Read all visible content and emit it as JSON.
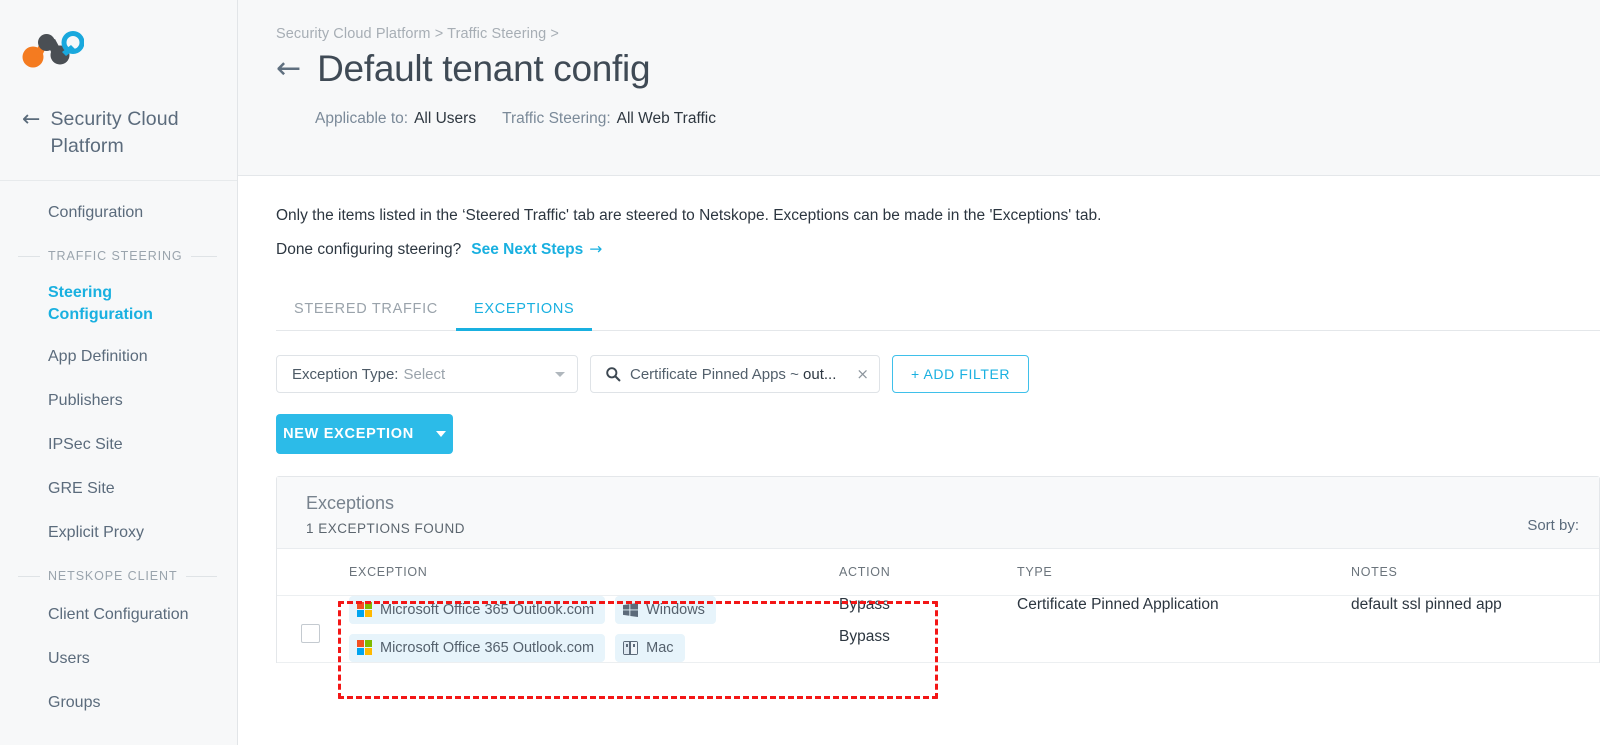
{
  "sidebar": {
    "logo_name": "netskope-logo",
    "back_arrow": "←",
    "brand": "Security Cloud Platform",
    "items": [
      {
        "label": "Configuration",
        "active": false
      },
      {
        "label": "Steering Configuration",
        "active": true
      },
      {
        "label": "App Definition",
        "active": false
      },
      {
        "label": "Publishers",
        "active": false
      },
      {
        "label": "IPSec Site",
        "active": false
      },
      {
        "label": "GRE Site",
        "active": false
      },
      {
        "label": "Explicit Proxy",
        "active": false
      },
      {
        "label": "Client Configuration",
        "active": false
      },
      {
        "label": "Users",
        "active": false
      },
      {
        "label": "Groups",
        "active": false
      }
    ],
    "group_traffic_steering": "TRAFFIC STEERING",
    "group_netskope_client": "NETSKOPE CLIENT"
  },
  "header": {
    "breadcrumb": "Security Cloud Platform > Traffic Steering >",
    "back_arrow": "←",
    "title": "Default tenant config",
    "meta": [
      {
        "label": "Applicable to:",
        "value": "All Users"
      },
      {
        "label": "Traffic Steering:",
        "value": "All Web Traffic"
      }
    ]
  },
  "body": {
    "info_line": "Only the items listed in the ‘Steered Traffic' tab are steered to Netskope. Exceptions can be made in the 'Exceptions' tab.",
    "prompt": "Done configuring steering?",
    "link_label": "See Next Steps",
    "link_arrow": "→"
  },
  "tabs": [
    {
      "label": "STEERED TRAFFIC",
      "active": false
    },
    {
      "label": "EXCEPTIONS",
      "active": true
    }
  ],
  "filters": {
    "exception_type_label": "Exception Type:",
    "exception_type_placeholder": "Select",
    "search_icon": "search-icon",
    "search_query_prefix": "Certificate Pinned Apps ~ ",
    "search_query_value": "out...",
    "clear_icon": "×",
    "add_filter_label": "+ ADD FILTER",
    "new_exception_label": "NEW EXCEPTION"
  },
  "card": {
    "title": "Exceptions",
    "count_label": "1 EXCEPTIONS FOUND",
    "sort_by_label": "Sort by:"
  },
  "table": {
    "columns": [
      "EXCEPTION",
      "ACTION",
      "TYPE",
      "NOTES"
    ],
    "rows": [
      {
        "checked": false,
        "exceptions": [
          {
            "app": "Microsoft Office 365 Outlook.com",
            "app_icon": "microsoft-icon",
            "platform": "Windows",
            "platform_icon": "windows-icon",
            "action": "Bypass"
          },
          {
            "app": "Microsoft Office 365 Outlook.com",
            "app_icon": "microsoft-icon",
            "platform": "Mac",
            "platform_icon": "mac-finder-icon",
            "action": "Bypass"
          }
        ],
        "type": "Certificate Pinned Application",
        "notes": "default ssl pinned app"
      }
    ]
  },
  "colors": {
    "accent": "#19b0e0",
    "button": "#2cbbe8",
    "annotation": "#f31616",
    "chip_bg": "#e7f4fb",
    "logo_orange": "#f47b20",
    "logo_dark": "#4a4f54",
    "logo_blue": "#19a8dd",
    "ms_red": "#f25022",
    "ms_green": "#7fba00",
    "ms_blue": "#00a4ef",
    "ms_yellow": "#ffb900"
  }
}
